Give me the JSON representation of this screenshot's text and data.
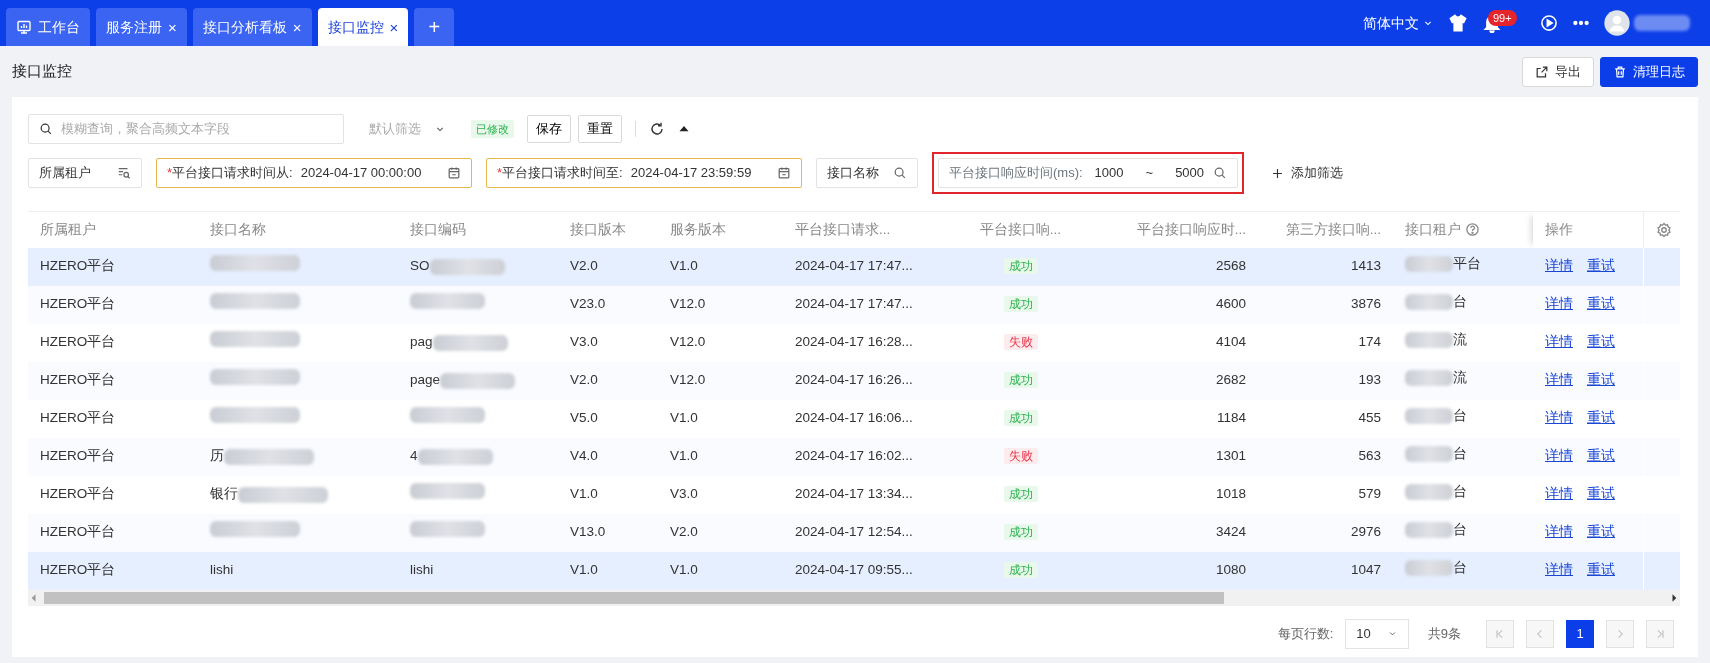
{
  "tabs": [
    {
      "label": "工作台",
      "selected": false
    },
    {
      "label": "服务注册",
      "close": "×",
      "selected": false
    },
    {
      "label": "接口分析看板",
      "close": "×",
      "selected": false
    },
    {
      "label": "接口监控",
      "close": "×",
      "selected": true
    }
  ],
  "add_tab": "+",
  "header": {
    "language": "简体中文",
    "notification_count": "99+"
  },
  "page": {
    "title": "接口监控",
    "buttons": [
      {
        "label": "导出",
        "kind": "outline"
      },
      {
        "label": "清理日志",
        "kind": "primary"
      }
    ]
  },
  "toolbar": {
    "search_placeholder": "模糊查询，聚合高频文本字段",
    "filter_preset": "默认筛选",
    "modified_tag": "已修改",
    "buttons": [
      "保存",
      "重置"
    ]
  },
  "filters": [
    {
      "kind": "lookup",
      "label": "所属租户"
    },
    {
      "kind": "date",
      "required_mark": "*",
      "label": "平台接口请求时间从:",
      "value": "2024-04-17 00:00:00"
    },
    {
      "kind": "date",
      "required_mark": "*",
      "label": "平台接口请求时间至:",
      "value": "2024-04-17 23:59:59"
    },
    {
      "kind": "search",
      "label": "接口名称"
    },
    {
      "kind": "range",
      "label": "平台接口响应时间(ms):",
      "from": "1000",
      "separator": "~",
      "to": "5000",
      "highlighted": true
    }
  ],
  "add_filter": "添加筛选",
  "table": {
    "columns": [
      {
        "label": "所属租户"
      },
      {
        "label": "接口名称"
      },
      {
        "label": "接口编码"
      },
      {
        "label": "接口版本"
      },
      {
        "label": "服务版本"
      },
      {
        "label": "平台接口请求..."
      },
      {
        "label": "平台接口响..."
      },
      {
        "label": "平台接口响应时..."
      },
      {
        "label": "第三方接口响..."
      },
      {
        "label": "接口租户",
        "help": true
      },
      {
        "label": "操作"
      }
    ],
    "rows": [
      {
        "highlighted": true,
        "tenant": "HZERO平台",
        "name": {
          "redacted": true
        },
        "code": {
          "text": "SO",
          "redacted": true
        },
        "api_version": "V2.0",
        "service_version": "V1.0",
        "request_time": "2024-04-17 17:47...",
        "status": {
          "text": "成功",
          "kind": "success"
        },
        "platform_ms": "2568",
        "third_party_ms": "1413",
        "api_tenant": {
          "redacted": true,
          "text": "平台"
        },
        "actions": [
          "详情",
          "重试"
        ]
      },
      {
        "highlighted": false,
        "tenant": "HZERO平台",
        "name": {
          "redacted": true
        },
        "code": {
          "redacted": true
        },
        "api_version": "V23.0",
        "service_version": "V12.0",
        "request_time": "2024-04-17 17:47...",
        "status": {
          "text": "成功",
          "kind": "success"
        },
        "platform_ms": "4600",
        "third_party_ms": "3876",
        "api_tenant": {
          "redacted": true,
          "text": "台"
        },
        "actions": [
          "详情",
          "重试"
        ]
      },
      {
        "highlighted": false,
        "tenant": "HZERO平台",
        "name": {
          "redacted": true
        },
        "code": {
          "text": "pag",
          "redacted": true
        },
        "api_version": "V3.0",
        "service_version": "V12.0",
        "request_time": "2024-04-17 16:28...",
        "status": {
          "text": "失败",
          "kind": "fail"
        },
        "platform_ms": "4104",
        "third_party_ms": "174",
        "api_tenant": {
          "redacted": true,
          "text": "流"
        },
        "actions": [
          "详情",
          "重试"
        ]
      },
      {
        "highlighted": false,
        "tenant": "HZERO平台",
        "name": {
          "redacted": true
        },
        "code": {
          "text": "page",
          "redacted": true
        },
        "api_version": "V2.0",
        "service_version": "V12.0",
        "request_time": "2024-04-17 16:26...",
        "status": {
          "text": "成功",
          "kind": "success"
        },
        "platform_ms": "2682",
        "third_party_ms": "193",
        "api_tenant": {
          "redacted": true,
          "text": "流"
        },
        "actions": [
          "详情",
          "重试"
        ]
      },
      {
        "highlighted": false,
        "tenant": "HZERO平台",
        "name": {
          "redacted": true
        },
        "code": {
          "redacted": true
        },
        "api_version": "V5.0",
        "service_version": "V1.0",
        "request_time": "2024-04-17 16:06...",
        "status": {
          "text": "成功",
          "kind": "success"
        },
        "platform_ms": "1184",
        "third_party_ms": "455",
        "api_tenant": {
          "redacted": true,
          "text": "台"
        },
        "actions": [
          "详情",
          "重试"
        ]
      },
      {
        "highlighted": false,
        "tenant": "HZERO平台",
        "name": {
          "text": "历",
          "redacted": true
        },
        "code": {
          "text": "4",
          "redacted": true
        },
        "api_version": "V4.0",
        "service_version": "V1.0",
        "request_time": "2024-04-17 16:02...",
        "status": {
          "text": "失败",
          "kind": "fail"
        },
        "platform_ms": "1301",
        "third_party_ms": "563",
        "api_tenant": {
          "redacted": true,
          "text": "台"
        },
        "actions": [
          "详情",
          "重试"
        ]
      },
      {
        "highlighted": false,
        "tenant": "HZERO平台",
        "name": {
          "text": "银行",
          "redacted": true
        },
        "code": {
          "redacted": true
        },
        "api_version": "V1.0",
        "service_version": "V3.0",
        "request_time": "2024-04-17 13:34...",
        "status": {
          "text": "成功",
          "kind": "success"
        },
        "platform_ms": "1018",
        "third_party_ms": "579",
        "api_tenant": {
          "redacted": true,
          "text": "台"
        },
        "actions": [
          "详情",
          "重试"
        ]
      },
      {
        "highlighted": false,
        "tenant": "HZERO平台",
        "name": {
          "redacted": true
        },
        "code": {
          "redacted": true
        },
        "api_version": "V13.0",
        "service_version": "V2.0",
        "request_time": "2024-04-17 12:54...",
        "status": {
          "text": "成功",
          "kind": "success"
        },
        "platform_ms": "3424",
        "third_party_ms": "2976",
        "api_tenant": {
          "redacted": true,
          "text": "台"
        },
        "actions": [
          "详情",
          "重试"
        ]
      },
      {
        "highlighted": true,
        "tenant": "HZERO平台",
        "name": {
          "text": "lishi",
          "redacted": false
        },
        "code": {
          "text": "lishi",
          "redacted": false
        },
        "api_version": "V1.0",
        "service_version": "V1.0",
        "request_time": "2024-04-17 09:55...",
        "status": {
          "text": "成功",
          "kind": "success"
        },
        "platform_ms": "1080",
        "third_party_ms": "1047",
        "api_tenant": {
          "redacted": true,
          "text": "台"
        },
        "actions": [
          "详情",
          "重试"
        ]
      }
    ]
  },
  "pagination": {
    "page_size_label": "每页行数:",
    "page_size": "10",
    "total": "共9条",
    "pages": [
      {
        "label": "1",
        "selected": true
      }
    ],
    "first_disabled": true
  }
}
